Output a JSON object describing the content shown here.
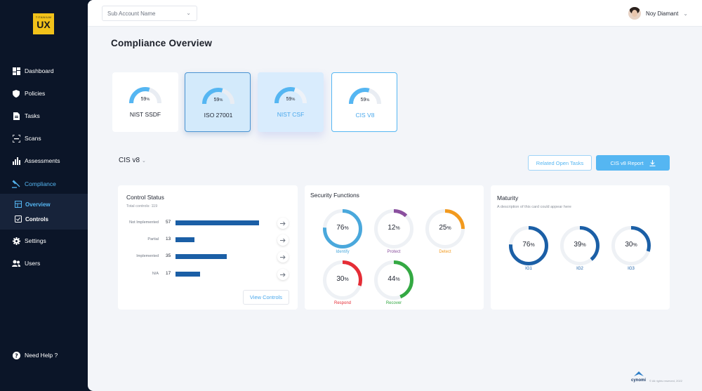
{
  "logo": {
    "top_text": "TITANIUM",
    "big_text": "UX"
  },
  "sidebar": {
    "items": [
      {
        "label": "Dashboard",
        "icon": "dashboard-icon"
      },
      {
        "label": "Policies",
        "icon": "shield-icon"
      },
      {
        "label": "Tasks",
        "icon": "document-icon"
      },
      {
        "label": "Scans",
        "icon": "scan-icon"
      },
      {
        "label": "Assessments",
        "icon": "bar-chart-icon"
      },
      {
        "label": "Compliance",
        "icon": "gavel-icon"
      },
      {
        "label": "Settings",
        "icon": "gear-icon"
      },
      {
        "label": "Users",
        "icon": "users-icon"
      }
    ],
    "sub_items": [
      {
        "label": "Overview",
        "icon": "overview-icon"
      },
      {
        "label": "Controls",
        "icon": "controls-icon"
      }
    ],
    "help_label": "Need Help ?"
  },
  "topbar": {
    "account_placeholder": "Sub Account Name",
    "user_name": "Noy Diamant"
  },
  "page": {
    "title": "Compliance  Overview"
  },
  "frameworks": [
    {
      "name": "NIST SSDF",
      "value": "59",
      "unit": "%",
      "fraction": 0.59
    },
    {
      "name": "ISO 27001",
      "value": "59",
      "unit": "%",
      "fraction": 0.59
    },
    {
      "name": "NIST CSF",
      "value": "59",
      "unit": "%",
      "fraction": 0.59
    },
    {
      "name": "CIS V8",
      "value": "59",
      "unit": "%",
      "fraction": 0.59
    }
  ],
  "selected_framework": "CIS v8",
  "actions": {
    "related_tasks": "Related Open Tasks",
    "report": "CIS v8 Report"
  },
  "control_status": {
    "title": "Control Status",
    "subtitle": "Total controls: 119",
    "rows": [
      {
        "label": "Not Implemented",
        "count": "57",
        "value": 57
      },
      {
        "label": "Partial",
        "count": "13",
        "value": 13
      },
      {
        "label": "Implemented",
        "count": "35",
        "value": 35
      },
      {
        "label": "N/A",
        "count": "17",
        "value": 17
      }
    ],
    "max_value": 57,
    "view_button": "View Controls"
  },
  "security_functions": {
    "title": "Security Functions",
    "items": [
      {
        "label": "Identify",
        "value": "76",
        "unit": "%",
        "fraction": 0.76,
        "color": "#4aa8dc"
      },
      {
        "label": "Protect",
        "value": "12",
        "unit": "%",
        "fraction": 0.12,
        "color": "#8a4f9e"
      },
      {
        "label": "Detect",
        "value": "25",
        "unit": "%",
        "fraction": 0.25,
        "color": "#f29a1e"
      },
      {
        "label": "Respond",
        "value": "30",
        "unit": "%",
        "fraction": 0.3,
        "color": "#e52d36"
      },
      {
        "label": "Recover",
        "value": "44",
        "unit": "%",
        "fraction": 0.44,
        "color": "#34a943"
      }
    ]
  },
  "maturity": {
    "title": "Maturity",
    "subtitle": "A description of this card could appear here",
    "items": [
      {
        "label": "IG1",
        "value": "76",
        "unit": "%",
        "fraction": 0.76,
        "color": "#1b5fa6"
      },
      {
        "label": "IG2",
        "value": "39",
        "unit": "%",
        "fraction": 0.39,
        "color": "#1b5fa6"
      },
      {
        "label": "IG3",
        "value": "30",
        "unit": "%",
        "fraction": 0.3,
        "color": "#1b5fa6"
      }
    ]
  },
  "footer": {
    "brand": "cynomi",
    "copyright": "© All rights reserved, 2022"
  }
}
